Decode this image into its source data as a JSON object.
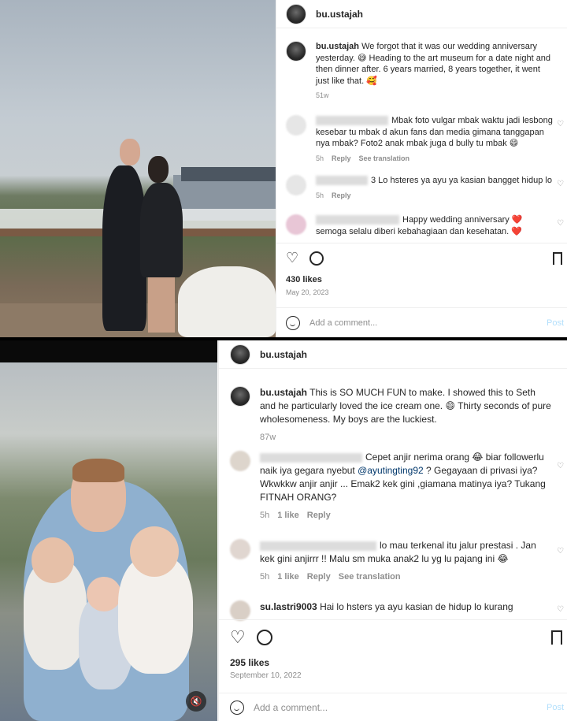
{
  "post1": {
    "username": "bu.ustajah",
    "caption_user": "bu.ustajah",
    "caption": "We forgot that it was our wedding anniversary yesterday. 😅 Heading to the art museum for a date night and then dinner after. 6 years married, 8 years together, it went just like that. 🥰",
    "caption_age": "51w",
    "comments": [
      {
        "text": "Mbak foto vulgar mbak waktu jadi lesbong kesebar tu mbak d akun fans dan media gimana tanggapan nya mbak? Foto2 anak mbak juga d bully tu mbak 😄",
        "time": "5h",
        "reply": "Reply",
        "translation": "See translation"
      },
      {
        "text": "3 Lo hsteres ya ayu ya kasian bangget hidup lo",
        "time": "5h",
        "reply": "Reply"
      },
      {
        "text": "Happy wedding anniversary ❤️ semoga selalu diberi kebahagiaan dan kesehatan. ❤️",
        "time": "",
        "reply": ""
      }
    ],
    "likes": "430 likes",
    "date": "May 20, 2023",
    "add_comment": "Add a comment...",
    "post_btn": "Post"
  },
  "post2": {
    "username": "bu.ustajah",
    "caption_user": "bu.ustajah",
    "caption": "This is SO MUCH FUN to make. I showed this to Seth and he particularly loved the ice cream one. 😄 Thirty seconds of pure wholesomeness. My boys are the luckiest.",
    "caption_age": "87w",
    "comments": [
      {
        "text_pre": "Cepet anjir nerima orang 😂 biar followerlu naik iya gegara nyebut ",
        "mention": "@ayutingting92",
        "text_post": " ? Gegayaan di privasi iya? Wkwkkw anjir anjir ... Emak2 kek gini ,giamana matinya iya? Tukang FITNAH ORANG?",
        "time": "5h",
        "likes": "1 like",
        "reply": "Reply"
      },
      {
        "text": "lo mau terkenal itu jalur prestasi . Jan kek gini anjirrr !! Malu sm muka anak2 lu yg lu pajang ini 😂",
        "time": "5h",
        "likes": "1 like",
        "reply": "Reply",
        "translation": "See translation"
      },
      {
        "user": "su.lastri9003",
        "text": "Hai lo hsters ya ayu kasian de hidup lo kurang"
      }
    ],
    "likes": "295 likes",
    "date": "September 10, 2022",
    "add_comment": "Add a comment...",
    "post_btn": "Post"
  }
}
